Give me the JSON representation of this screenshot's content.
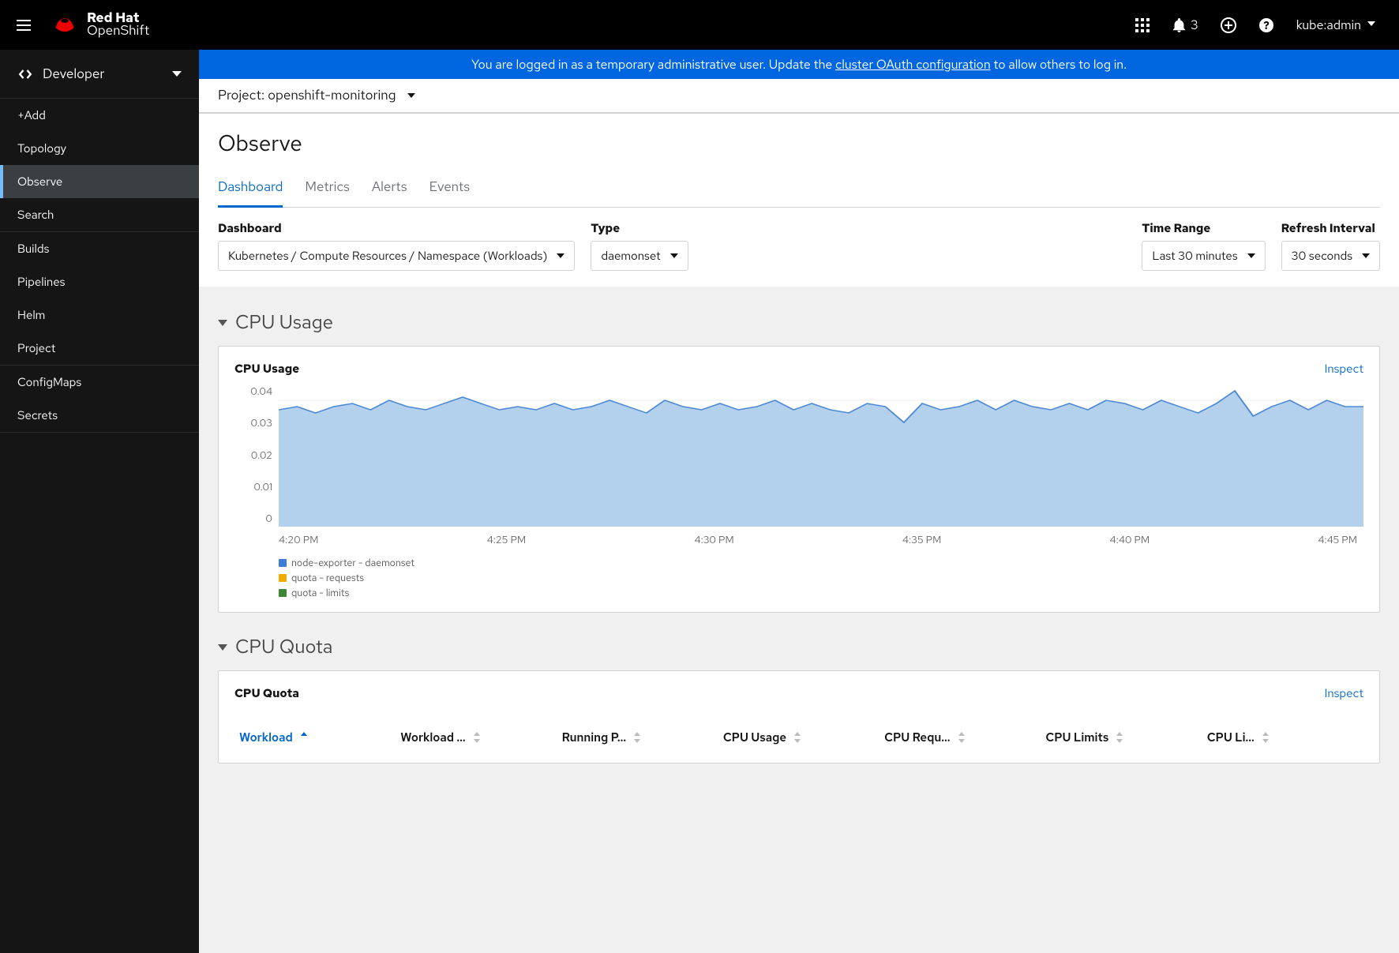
{
  "colors": {
    "accent": "#0066cc",
    "plot_fill": "#a6c8ea",
    "plot_stroke": "#4c88d5"
  },
  "header": {
    "brand_line1": "Red Hat",
    "brand_line2": "OpenShift",
    "notifications_count": "3",
    "username": "kube:admin"
  },
  "sidebar": {
    "perspective": "Developer",
    "groups": [
      {
        "items": [
          {
            "label": "+Add"
          },
          {
            "label": "Topology"
          },
          {
            "label": "Observe",
            "active": true
          },
          {
            "label": "Search"
          }
        ]
      },
      {
        "items": [
          {
            "label": "Builds"
          },
          {
            "label": "Pipelines"
          },
          {
            "label": "Helm"
          },
          {
            "label": "Project"
          }
        ]
      },
      {
        "items": [
          {
            "label": "ConfigMaps"
          },
          {
            "label": "Secrets"
          }
        ]
      }
    ]
  },
  "banner": {
    "pre": "You are logged in as a temporary administrative user. Update the ",
    "link": "cluster OAuth configuration",
    "post": " to allow others to log in."
  },
  "project": {
    "label": "Project:",
    "value": "openshift-monitoring"
  },
  "page_title": "Observe",
  "tabs": [
    {
      "label": "Dashboard",
      "active": true
    },
    {
      "label": "Metrics"
    },
    {
      "label": "Alerts"
    },
    {
      "label": "Events"
    }
  ],
  "toolbar": {
    "dashboard_label": "Dashboard",
    "dashboard_value": "Kubernetes / Compute Resources / Namespace (Workloads)",
    "type_label": "Type",
    "type_value": "daemonset",
    "timerange_label": "Time Range",
    "timerange_value": "Last 30 minutes",
    "refresh_label": "Refresh Interval",
    "refresh_value": "30 seconds"
  },
  "sections": {
    "cpu_usage_title": "CPU Usage",
    "cpu_quota_title": "CPU Quota"
  },
  "cpu_usage_card": {
    "title": "CPU Usage",
    "inspect": "Inspect",
    "legend": [
      {
        "label": "node-exporter - daemonset",
        "color": "#3b7dd8"
      },
      {
        "label": "quota - requests",
        "color": "#f0ab00"
      },
      {
        "label": "quota - limits",
        "color": "#3d8635"
      }
    ]
  },
  "cpu_quota_card": {
    "title": "CPU Quota",
    "inspect": "Inspect",
    "columns": [
      {
        "label": "Workload",
        "sorted": true
      },
      {
        "label": "Workload ..."
      },
      {
        "label": "Running P..."
      },
      {
        "label": "CPU Usage"
      },
      {
        "label": "CPU Requ..."
      },
      {
        "label": "CPU Limits"
      },
      {
        "label": "CPU Li..."
      }
    ]
  },
  "chart_data": {
    "type": "area",
    "title": "CPU Usage",
    "xlabel": "",
    "ylabel": "",
    "ylim": [
      0,
      0.045
    ],
    "y_ticks": [
      0,
      0.01,
      0.02,
      0.03,
      0.04
    ],
    "x_ticks": [
      "4:20 PM",
      "4:25 PM",
      "4:30 PM",
      "4:35 PM",
      "4:40 PM",
      "4:45 PM"
    ],
    "series": [
      {
        "name": "node-exporter - daemonset",
        "color": "#3b7dd8",
        "values": [
          0.037,
          0.038,
          0.036,
          0.038,
          0.039,
          0.037,
          0.04,
          0.038,
          0.037,
          0.039,
          0.041,
          0.039,
          0.037,
          0.038,
          0.037,
          0.039,
          0.037,
          0.038,
          0.04,
          0.038,
          0.036,
          0.04,
          0.038,
          0.037,
          0.039,
          0.037,
          0.038,
          0.04,
          0.037,
          0.039,
          0.037,
          0.036,
          0.039,
          0.038,
          0.033,
          0.039,
          0.037,
          0.038,
          0.04,
          0.037,
          0.04,
          0.038,
          0.037,
          0.039,
          0.037,
          0.04,
          0.039,
          0.037,
          0.04,
          0.038,
          0.036,
          0.039,
          0.043,
          0.035,
          0.038,
          0.04,
          0.037,
          0.04,
          0.038,
          0.038
        ]
      },
      {
        "name": "quota - requests",
        "color": "#f0ab00",
        "values": []
      },
      {
        "name": "quota - limits",
        "color": "#3d8635",
        "values": []
      }
    ]
  }
}
